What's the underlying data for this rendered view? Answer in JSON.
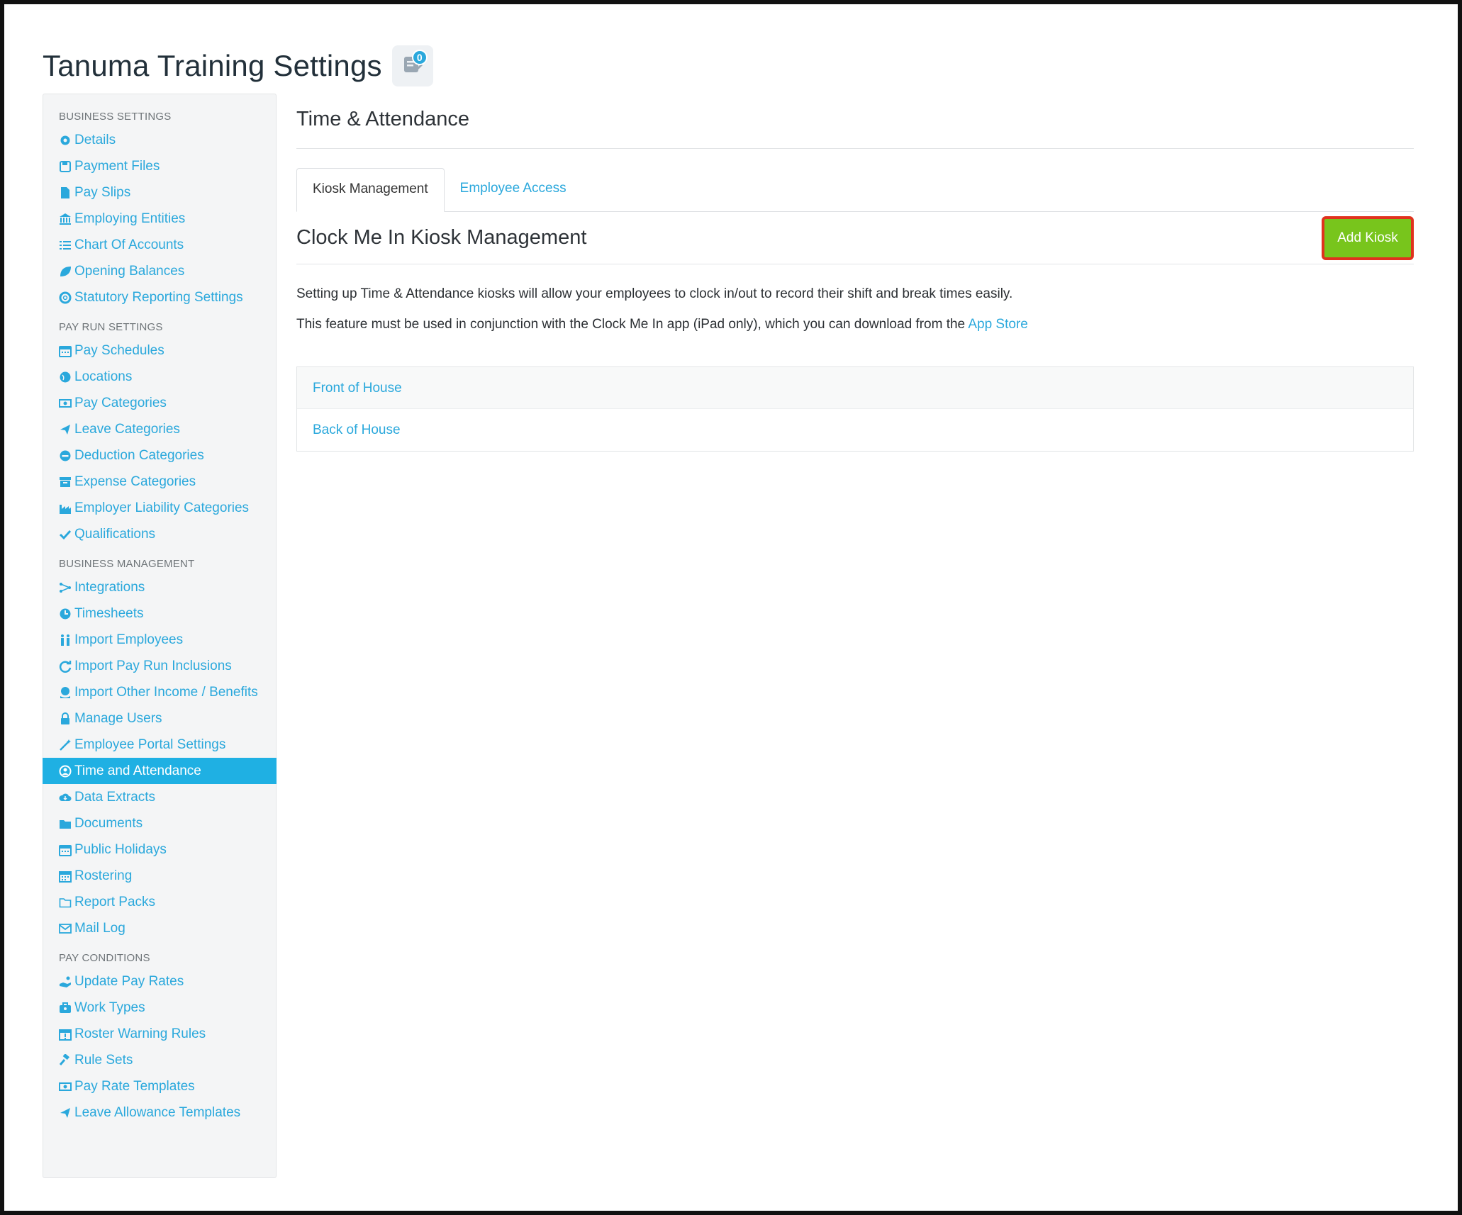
{
  "page": {
    "title": "Tanuma Training Settings",
    "notification_count": "0"
  },
  "sidebar": {
    "groups": [
      {
        "heading": "BUSINESS SETTINGS",
        "items": [
          {
            "label": "Details",
            "icon": "gear-icon"
          },
          {
            "label": "Payment Files",
            "icon": "floppy-disk-icon"
          },
          {
            "label": "Pay Slips",
            "icon": "file-icon"
          },
          {
            "label": "Employing Entities",
            "icon": "bank-icon"
          },
          {
            "label": "Chart Of Accounts",
            "icon": "list-icon"
          },
          {
            "label": "Opening Balances",
            "icon": "leaf-icon"
          },
          {
            "label": "Statutory Reporting Settings",
            "icon": "lifebuoy-icon"
          }
        ]
      },
      {
        "heading": "PAY RUN SETTINGS",
        "items": [
          {
            "label": "Pay Schedules",
            "icon": "calendar-icon"
          },
          {
            "label": "Locations",
            "icon": "globe-icon"
          },
          {
            "label": "Pay Categories",
            "icon": "money-icon"
          },
          {
            "label": "Leave Categories",
            "icon": "plane-icon"
          },
          {
            "label": "Deduction Categories",
            "icon": "minus-circle-icon"
          },
          {
            "label": "Expense Categories",
            "icon": "archive-icon"
          },
          {
            "label": "Employer Liability Categories",
            "icon": "industry-icon"
          },
          {
            "label": "Qualifications",
            "icon": "check-icon"
          }
        ]
      },
      {
        "heading": "BUSINESS MANAGEMENT",
        "items": [
          {
            "label": "Integrations",
            "icon": "share-nodes-icon"
          },
          {
            "label": "Timesheets",
            "icon": "clock-icon"
          },
          {
            "label": "Import Employees",
            "icon": "people-icon"
          },
          {
            "label": "Import Pay Run Inclusions",
            "icon": "refresh-icon"
          },
          {
            "label": "Import Other Income / Benefits",
            "icon": "hand-heart-icon"
          },
          {
            "label": "Manage Users",
            "icon": "lock-icon"
          },
          {
            "label": "Employee Portal Settings",
            "icon": "magic-wand-icon"
          },
          {
            "label": "Time and Attendance",
            "icon": "user-circle-icon",
            "active": true
          },
          {
            "label": "Data Extracts",
            "icon": "cloud-download-icon"
          },
          {
            "label": "Documents",
            "icon": "folder-icon"
          },
          {
            "label": "Public Holidays",
            "icon": "calendar-icon"
          },
          {
            "label": "Rostering",
            "icon": "calendar-grid-icon"
          },
          {
            "label": "Report Packs",
            "icon": "folder-outline-icon"
          },
          {
            "label": "Mail Log",
            "icon": "envelope-icon"
          }
        ]
      },
      {
        "heading": "PAY CONDITIONS",
        "items": [
          {
            "label": "Update Pay Rates",
            "icon": "hand-coins-icon"
          },
          {
            "label": "Work Types",
            "icon": "briefcase-icon"
          },
          {
            "label": "Roster Warning Rules",
            "icon": "calendar-alert-icon"
          },
          {
            "label": "Rule Sets",
            "icon": "gavel-icon"
          },
          {
            "label": "Pay Rate Templates",
            "icon": "money-icon"
          },
          {
            "label": "Leave Allowance Templates",
            "icon": "plane-icon"
          }
        ]
      }
    ]
  },
  "main": {
    "section_title": "Time & Attendance",
    "tabs": [
      {
        "label": "Kiosk Management",
        "active": true
      },
      {
        "label": "Employee Access",
        "active": false
      }
    ],
    "kiosk_title": "Clock Me In Kiosk Management",
    "add_button": "Add Kiosk",
    "desc1": "Setting up Time & Attendance kiosks will allow your employees to clock in/out to record their shift and break times easily.",
    "desc2_prefix": "This feature must be used in conjunction with the Clock Me In app (iPad only), which you can download from the",
    "desc2_link": "App Store",
    "kiosks": [
      "Front of House",
      "Back of House"
    ]
  },
  "colors": {
    "accent": "#2aa8dc",
    "active_nav": "#1fb0e3",
    "add_button": "#78c51c",
    "highlight_border": "#e0321e"
  }
}
